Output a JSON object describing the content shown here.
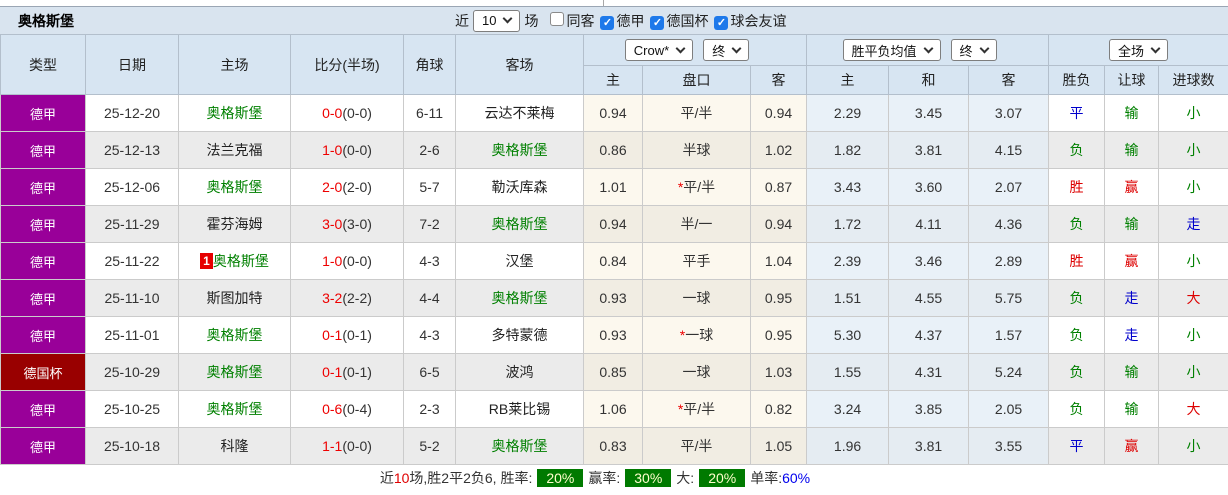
{
  "title": "奥格斯堡",
  "controls": {
    "near_label": "近",
    "near_count": "10",
    "matches_label": "场",
    "filters": [
      {
        "label": "同客",
        "checked": false
      },
      {
        "label": "德甲",
        "checked": true
      },
      {
        "label": "德国杯",
        "checked": true
      },
      {
        "label": "球会友谊",
        "checked": true
      }
    ]
  },
  "header": {
    "columns_left": [
      "类型",
      "日期",
      "主场",
      "比分(半场)",
      "角球",
      "客场"
    ],
    "selects": {
      "odds_company": "Crow*",
      "odds_stage": "终",
      "avg": "胜平负均值",
      "avg_stage": "终",
      "scope": "全场"
    },
    "columns_odds": [
      "主",
      "盘口",
      "客"
    ],
    "columns_avg": [
      "主",
      "和",
      "客"
    ],
    "columns_result": [
      "胜负",
      "让球",
      "进球数"
    ]
  },
  "rows": [
    {
      "league": "德甲",
      "league_type": "league",
      "date": "25-12-20",
      "home": "奥格斯堡",
      "home_self": true,
      "home_badge": "",
      "score": "0-0",
      "half": "(0-0)",
      "corners": "6-11",
      "away": "云达不莱梅",
      "away_self": false,
      "odds_home": "0.94",
      "handicap": "平/半",
      "handicap_star": false,
      "odds_away": "0.94",
      "avg_home": "2.29",
      "avg_draw": "3.45",
      "avg_away": "3.07",
      "result": {
        "text": "平",
        "color": "blue"
      },
      "handicap_result": {
        "text": "输",
        "color": "green"
      },
      "goals": {
        "text": "小",
        "color": "green"
      }
    },
    {
      "league": "德甲",
      "league_type": "league",
      "date": "25-12-13",
      "home": "法兰克福",
      "home_self": false,
      "home_badge": "",
      "score": "1-0",
      "half": "(0-0)",
      "corners": "2-6",
      "away": "奥格斯堡",
      "away_self": true,
      "odds_home": "0.86",
      "handicap": "半球",
      "handicap_star": false,
      "odds_away": "1.02",
      "avg_home": "1.82",
      "avg_draw": "3.81",
      "avg_away": "4.15",
      "result": {
        "text": "负",
        "color": "green"
      },
      "handicap_result": {
        "text": "输",
        "color": "green"
      },
      "goals": {
        "text": "小",
        "color": "green"
      }
    },
    {
      "league": "德甲",
      "league_type": "league",
      "date": "25-12-06",
      "home": "奥格斯堡",
      "home_self": true,
      "home_badge": "",
      "score": "2-0",
      "half": "(2-0)",
      "corners": "5-7",
      "away": "勒沃库森",
      "away_self": false,
      "odds_home": "1.01",
      "handicap": "平/半",
      "handicap_star": true,
      "odds_away": "0.87",
      "avg_home": "3.43",
      "avg_draw": "3.60",
      "avg_away": "2.07",
      "result": {
        "text": "胜",
        "color": "red"
      },
      "handicap_result": {
        "text": "赢",
        "color": "red"
      },
      "goals": {
        "text": "小",
        "color": "green"
      }
    },
    {
      "league": "德甲",
      "league_type": "league",
      "date": "25-11-29",
      "home": "霍芬海姆",
      "home_self": false,
      "home_badge": "",
      "score": "3-0",
      "half": "(3-0)",
      "corners": "7-2",
      "away": "奥格斯堡",
      "away_self": true,
      "odds_home": "0.94",
      "handicap": "半/一",
      "handicap_star": false,
      "odds_away": "0.94",
      "avg_home": "1.72",
      "avg_draw": "4.11",
      "avg_away": "4.36",
      "result": {
        "text": "负",
        "color": "green"
      },
      "handicap_result": {
        "text": "输",
        "color": "green"
      },
      "goals": {
        "text": "走",
        "color": "blue"
      }
    },
    {
      "league": "德甲",
      "league_type": "league",
      "date": "25-11-22",
      "home": "奥格斯堡",
      "home_self": true,
      "home_badge": "1",
      "score": "1-0",
      "half": "(0-0)",
      "corners": "4-3",
      "away": "汉堡",
      "away_self": false,
      "odds_home": "0.84",
      "handicap": "平手",
      "handicap_star": false,
      "odds_away": "1.04",
      "avg_home": "2.39",
      "avg_draw": "3.46",
      "avg_away": "2.89",
      "result": {
        "text": "胜",
        "color": "red"
      },
      "handicap_result": {
        "text": "赢",
        "color": "red"
      },
      "goals": {
        "text": "小",
        "color": "green"
      }
    },
    {
      "league": "德甲",
      "league_type": "league",
      "date": "25-11-10",
      "home": "斯图加特",
      "home_self": false,
      "home_badge": "",
      "score": "3-2",
      "half": "(2-2)",
      "corners": "4-4",
      "away": "奥格斯堡",
      "away_self": true,
      "odds_home": "0.93",
      "handicap": "一球",
      "handicap_star": false,
      "odds_away": "0.95",
      "avg_home": "1.51",
      "avg_draw": "4.55",
      "avg_away": "5.75",
      "result": {
        "text": "负",
        "color": "green"
      },
      "handicap_result": {
        "text": "走",
        "color": "blue"
      },
      "goals": {
        "text": "大",
        "color": "red"
      }
    },
    {
      "league": "德甲",
      "league_type": "league",
      "date": "25-11-01",
      "home": "奥格斯堡",
      "home_self": true,
      "home_badge": "",
      "score": "0-1",
      "half": "(0-1)",
      "corners": "4-3",
      "away": "多特蒙德",
      "away_self": false,
      "odds_home": "0.93",
      "handicap": "一球",
      "handicap_star": true,
      "odds_away": "0.95",
      "avg_home": "5.30",
      "avg_draw": "4.37",
      "avg_away": "1.57",
      "result": {
        "text": "负",
        "color": "green"
      },
      "handicap_result": {
        "text": "走",
        "color": "blue"
      },
      "goals": {
        "text": "小",
        "color": "green"
      }
    },
    {
      "league": "德国杯",
      "league_type": "cup",
      "date": "25-10-29",
      "home": "奥格斯堡",
      "home_self": true,
      "home_badge": "",
      "score": "0-1",
      "half": "(0-1)",
      "corners": "6-5",
      "away": "波鸿",
      "away_self": false,
      "odds_home": "0.85",
      "handicap": "一球",
      "handicap_star": false,
      "odds_away": "1.03",
      "avg_home": "1.55",
      "avg_draw": "4.31",
      "avg_away": "5.24",
      "result": {
        "text": "负",
        "color": "green"
      },
      "handicap_result": {
        "text": "输",
        "color": "green"
      },
      "goals": {
        "text": "小",
        "color": "green"
      }
    },
    {
      "league": "德甲",
      "league_type": "league",
      "date": "25-10-25",
      "home": "奥格斯堡",
      "home_self": true,
      "home_badge": "",
      "score": "0-6",
      "half": "(0-4)",
      "corners": "2-3",
      "away": "RB莱比锡",
      "away_self": false,
      "odds_home": "1.06",
      "handicap": "平/半",
      "handicap_star": true,
      "odds_away": "0.82",
      "avg_home": "3.24",
      "avg_draw": "3.85",
      "avg_away": "2.05",
      "result": {
        "text": "负",
        "color": "green"
      },
      "handicap_result": {
        "text": "输",
        "color": "green"
      },
      "goals": {
        "text": "大",
        "color": "red"
      }
    },
    {
      "league": "德甲",
      "league_type": "league",
      "date": "25-10-18",
      "home": "科隆",
      "home_self": false,
      "home_badge": "",
      "score": "1-1",
      "half": "(0-0)",
      "corners": "5-2",
      "away": "奥格斯堡",
      "away_self": true,
      "odds_home": "0.83",
      "handicap": "平/半",
      "handicap_star": false,
      "odds_away": "1.05",
      "avg_home": "1.96",
      "avg_draw": "3.81",
      "avg_away": "3.55",
      "result": {
        "text": "平",
        "color": "blue"
      },
      "handicap_result": {
        "text": "赢",
        "color": "red"
      },
      "goals": {
        "text": "小",
        "color": "green"
      }
    }
  ],
  "footer": {
    "near_label": "近",
    "near_count": "10",
    "summary": "场,胜2平2负6, ",
    "win_rate_label": "胜率:",
    "win_rate": "20%",
    "handicap_rate_label": "赢率:",
    "handicap_rate": "30%",
    "big_rate_label": "大:",
    "big_rate": "20%",
    "single_rate_label": "单率:",
    "single_rate": "60%"
  },
  "colors": {
    "league_badge": "#990099",
    "cup_badge": "#990000",
    "win": "#dd0000",
    "draw": "#0000cc",
    "lose": "#008000",
    "self_team": "#008000",
    "score": "#ee0000",
    "rate_badge_bg": "#007a00",
    "checkbox_checked": "#1e79ea"
  }
}
